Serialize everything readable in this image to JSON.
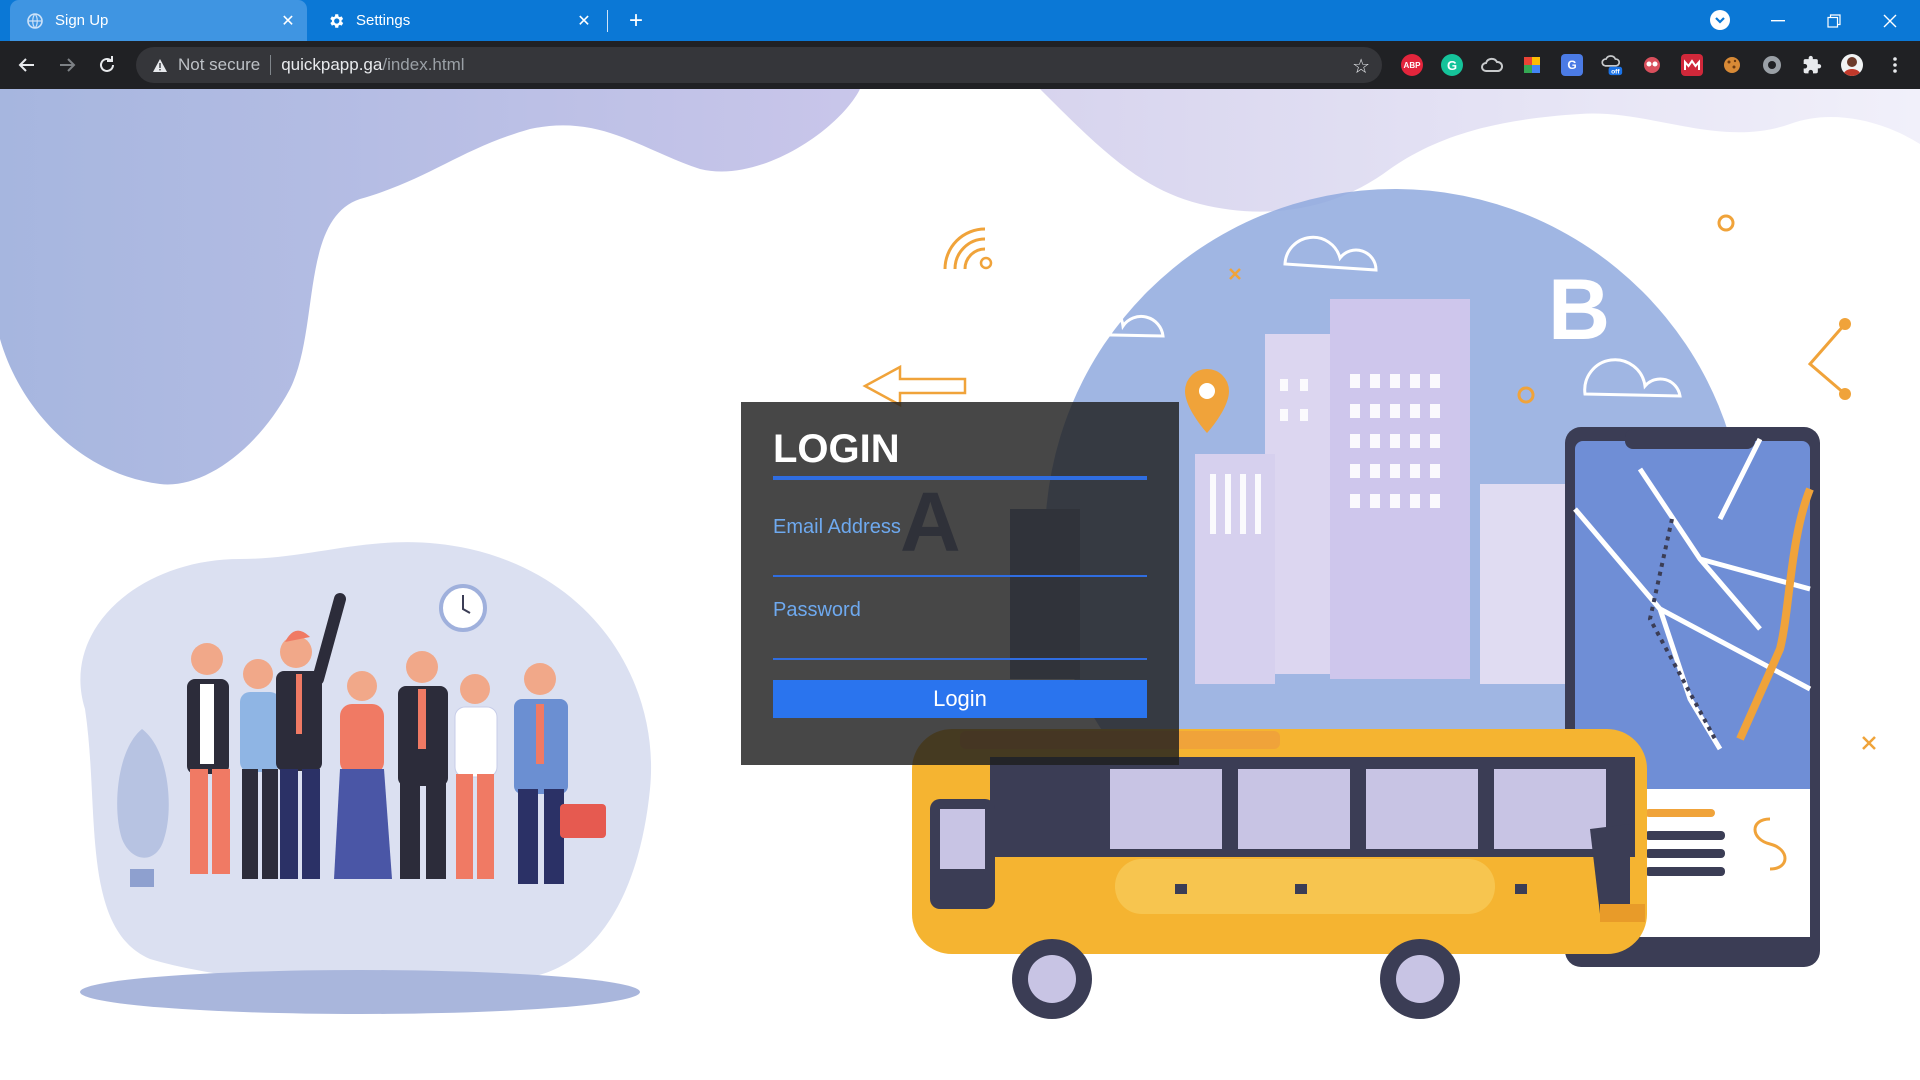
{
  "browser": {
    "tabs": [
      {
        "title": "Sign Up",
        "active": true
      },
      {
        "title": "Settings",
        "active": false
      }
    ],
    "address": {
      "security_label": "Not secure",
      "host": "quickpapp.ga",
      "path": "/index.html"
    },
    "extensions": [
      "adblock-plus-icon",
      "grammarly-icon",
      "cloud-extension-icon",
      "color-extension-icon",
      "translate-icon",
      "weather-off-icon",
      "mask-icon",
      "mendeley-icon",
      "cookie-icon",
      "record-icon",
      "puzzle-extensions-icon",
      "profile-avatar"
    ],
    "extension_badge": "off",
    "abp_label": "ABP"
  },
  "login": {
    "title": "LOGIN",
    "email_label": "Email Address",
    "email_value": "",
    "password_label": "Password",
    "password_value": "",
    "button_label": "Login"
  },
  "illustration": {
    "letter_a": "A",
    "letter_b": "B"
  },
  "colors": {
    "tabbar": "#0b78d6",
    "accent_blue": "#2a74ee",
    "bus_yellow": "#f5b431",
    "blob_purple": "#b8bfe6"
  }
}
